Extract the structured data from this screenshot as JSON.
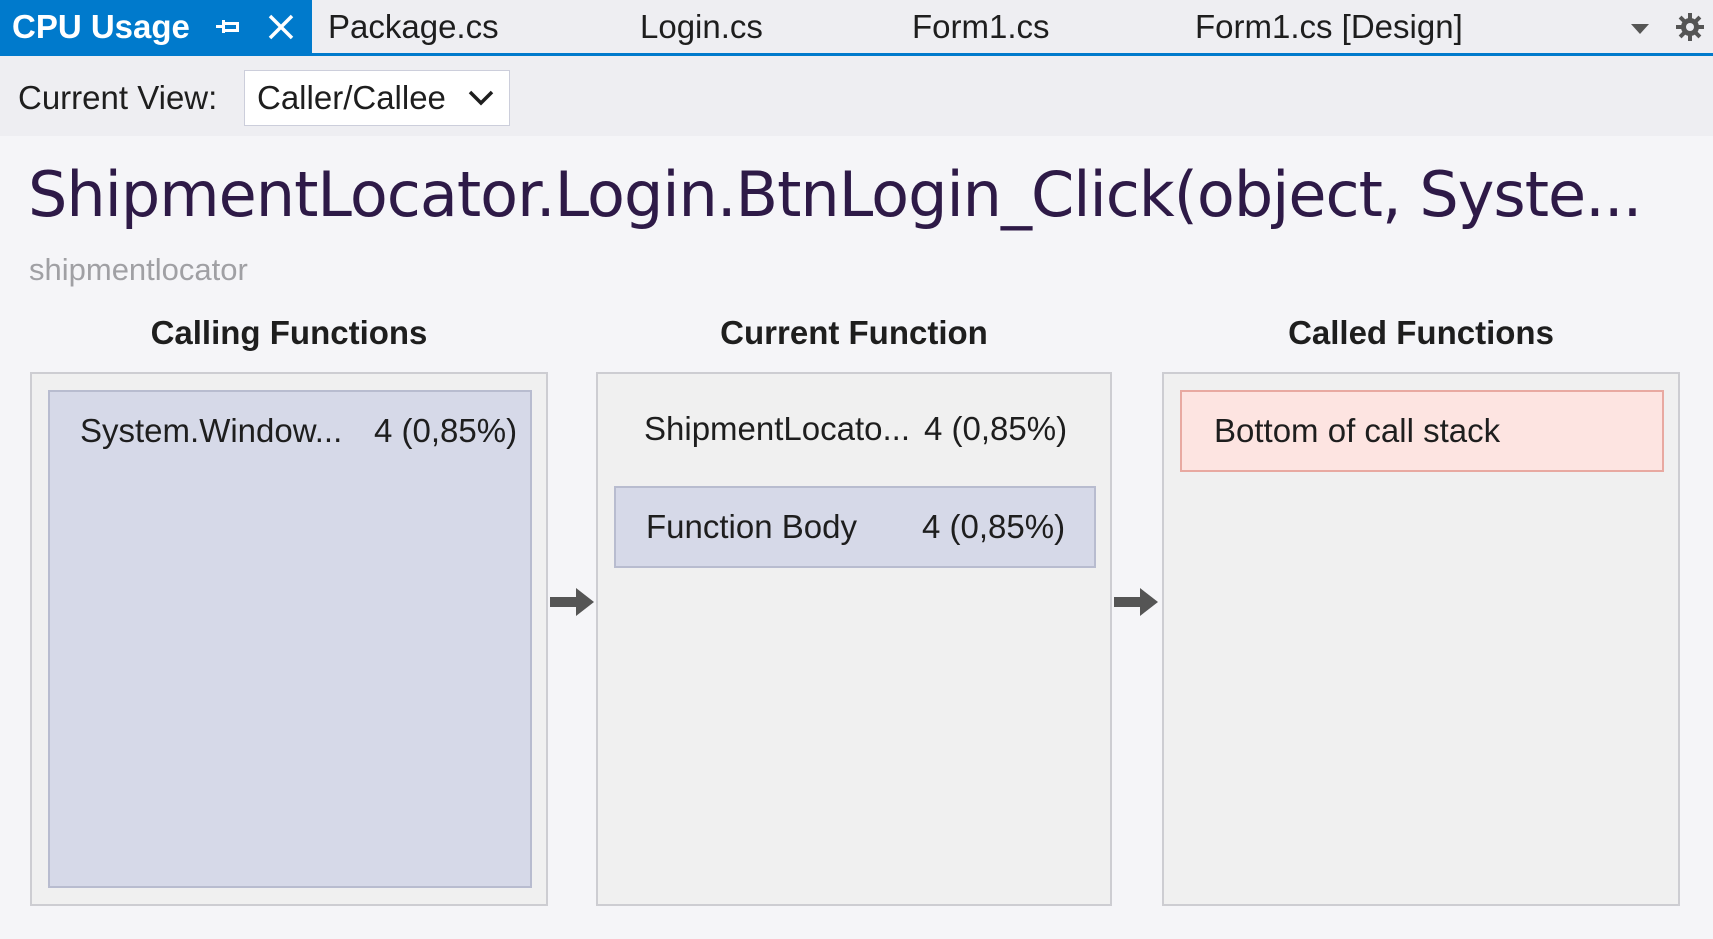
{
  "tabs": [
    {
      "label": "CPU Usage",
      "active": true
    },
    {
      "label": "Package.cs"
    },
    {
      "label": "Login.cs"
    },
    {
      "label": "Form1.cs"
    },
    {
      "label": "Form1.cs [Design]"
    }
  ],
  "icons": {
    "pin": "pin-icon",
    "close": "close-icon",
    "tab_dropdown": "chevron-down-icon",
    "settings": "gear-icon",
    "arrow": "arrow-right-icon"
  },
  "view": {
    "label": "Current View:",
    "selected": "Caller/Callee"
  },
  "header": {
    "title": "ShipmentLocator.Login.BtnLogin_Click(object, Syste...",
    "subtitle": "shipmentlocator"
  },
  "columns": {
    "calling": {
      "title": "Calling Functions",
      "rows": [
        {
          "name": "System.Window...",
          "value": "4 (0,85%)"
        }
      ]
    },
    "current": {
      "title": "Current Function",
      "rows": [
        {
          "name": "ShipmentLocato...",
          "value": "4 (0,85%)"
        },
        {
          "name": "Function Body",
          "value": "4 (0,85%)"
        }
      ]
    },
    "called": {
      "title": "Called Functions",
      "rows": [
        {
          "name": "Bottom of call stack"
        }
      ]
    }
  },
  "colors": {
    "accent": "#007acc",
    "title": "#2e1a47",
    "selected_block": "#d6d9e8",
    "bottom_stack": "#fde4e1"
  }
}
